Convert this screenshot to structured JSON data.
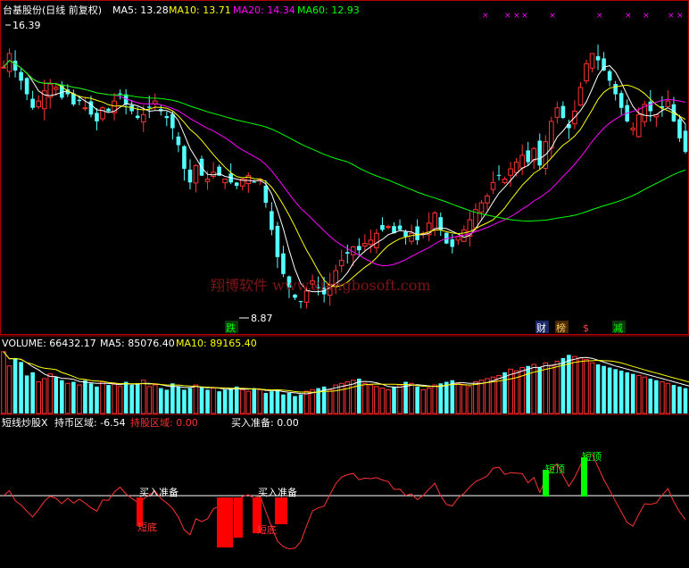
{
  "price_panel": {
    "stock_label": "台基股份(日线 前复权)",
    "ma5_label": "MA5: 13.28",
    "ma10_label": "MA10: 13.71",
    "ma20_label": "MA20: 14.34",
    "ma60_label": "MA60: 12.93",
    "high_label": "16.39",
    "low_label": "8.87",
    "watermark": "翔博软件 www.xiangbosoft.com"
  },
  "event_tags": [
    {
      "text": "跌",
      "color": "#00ff00",
      "bg": "#0a3a0a"
    },
    {
      "text": "财",
      "color": "#ffffff",
      "bg": "#1a2a6a"
    },
    {
      "text": "榜",
      "color": "#ffcc66",
      "bg": "#4a2a00"
    },
    {
      "text": "$",
      "color": "#ff4444",
      "bg": "#000000"
    },
    {
      "text": "减",
      "color": "#00ff00",
      "bg": "#0a3a0a"
    }
  ],
  "volume_panel": {
    "volume_label": "VOLUME: 66432.17",
    "ma5_label": "MA5: 85076.40",
    "ma10_label": "MA10: 89165.40"
  },
  "indicator_panel": {
    "name_label": "短线炒股X",
    "hold_coin_label": "持币区域: -6.54",
    "hold_stock_label": "持股区域: 0.00",
    "buy_ready_label": "买入准备: 0.00",
    "annotations": [
      "买入准备",
      "买入准备",
      "短底",
      "短底",
      "短顶",
      "短顶"
    ]
  },
  "colors": {
    "up": "#ff3232",
    "down": "#54ffff",
    "ma5": "#ffffff",
    "ma10": "#ffff00",
    "ma20": "#ff00ff",
    "ma60": "#00ff00",
    "panel_border": "#b00000",
    "buy_bar": "#ff0000",
    "sell_bar": "#00ff00"
  },
  "chart_data": {
    "type": "candlestick",
    "y_range": [
      8.3,
      17.2
    ],
    "close_path": [
      15.8,
      16.2,
      15.7,
      15.4,
      15.0,
      14.6,
      14.8,
      15.1,
      15.3,
      15.2,
      14.9,
      15.0,
      14.7,
      14.8,
      14.6,
      14.4,
      14.2,
      14.6,
      14.5,
      14.8,
      15.0,
      14.7,
      14.5,
      14.3,
      14.4,
      14.6,
      14.8,
      14.5,
      14.3,
      14.0,
      13.5,
      12.8,
      12.4,
      12.9,
      12.6,
      12.5,
      12.7,
      12.6,
      12.5,
      12.4,
      12.3,
      12.5,
      12.6,
      12.4,
      12.5,
      11.8,
      11.0,
      10.2,
      9.7,
      9.3,
      9.0,
      8.9,
      9.2,
      9.5,
      9.3,
      9.1,
      9.4,
      9.8,
      10.1,
      10.3,
      10.5,
      10.4,
      10.6,
      10.7,
      10.9,
      11.0,
      11.1,
      10.9,
      11.0,
      10.8,
      10.9,
      10.7,
      10.9,
      11.2,
      11.5,
      11.0,
      10.6,
      10.5,
      10.8,
      11.0,
      11.3,
      11.6,
      11.8,
      12.0,
      12.4,
      12.6,
      12.5,
      12.8,
      13.0,
      13.2,
      13.0,
      13.4,
      12.9,
      13.6,
      14.2,
      14.6,
      14.3,
      14.0,
      14.5,
      15.2,
      15.9,
      16.2,
      16.0,
      15.7,
      15.4,
      15.0,
      14.6,
      14.2,
      14.0,
      14.4,
      14.7,
      14.5,
      14.4,
      14.6,
      14.8,
      14.2,
      13.7,
      13.3
    ],
    "volume_path": [
      78,
      60,
      70,
      65,
      48,
      52,
      40,
      44,
      50,
      46,
      42,
      38,
      40,
      36,
      42,
      38,
      34,
      40,
      36,
      38,
      34,
      40,
      36,
      38,
      42,
      34,
      36,
      32,
      30,
      38,
      34,
      30,
      32,
      36,
      34,
      30,
      32,
      28,
      30,
      32,
      34,
      30,
      28,
      32,
      30,
      26,
      28,
      30,
      24,
      26,
      22,
      24,
      28,
      30,
      32,
      34,
      30,
      36,
      38,
      40,
      42,
      44,
      38,
      36,
      34,
      32,
      30,
      34,
      36,
      40,
      38,
      34,
      30,
      32,
      36,
      38,
      40,
      42,
      38,
      36,
      34,
      40,
      42,
      44,
      46,
      48,
      52,
      56,
      54,
      58,
      60,
      62,
      58,
      64,
      60,
      66,
      70,
      74,
      72,
      70,
      68,
      64,
      62,
      60,
      58,
      56,
      54,
      52,
      50,
      48,
      46,
      44,
      42,
      40,
      38,
      36,
      34,
      32,
      30,
      28
    ]
  }
}
